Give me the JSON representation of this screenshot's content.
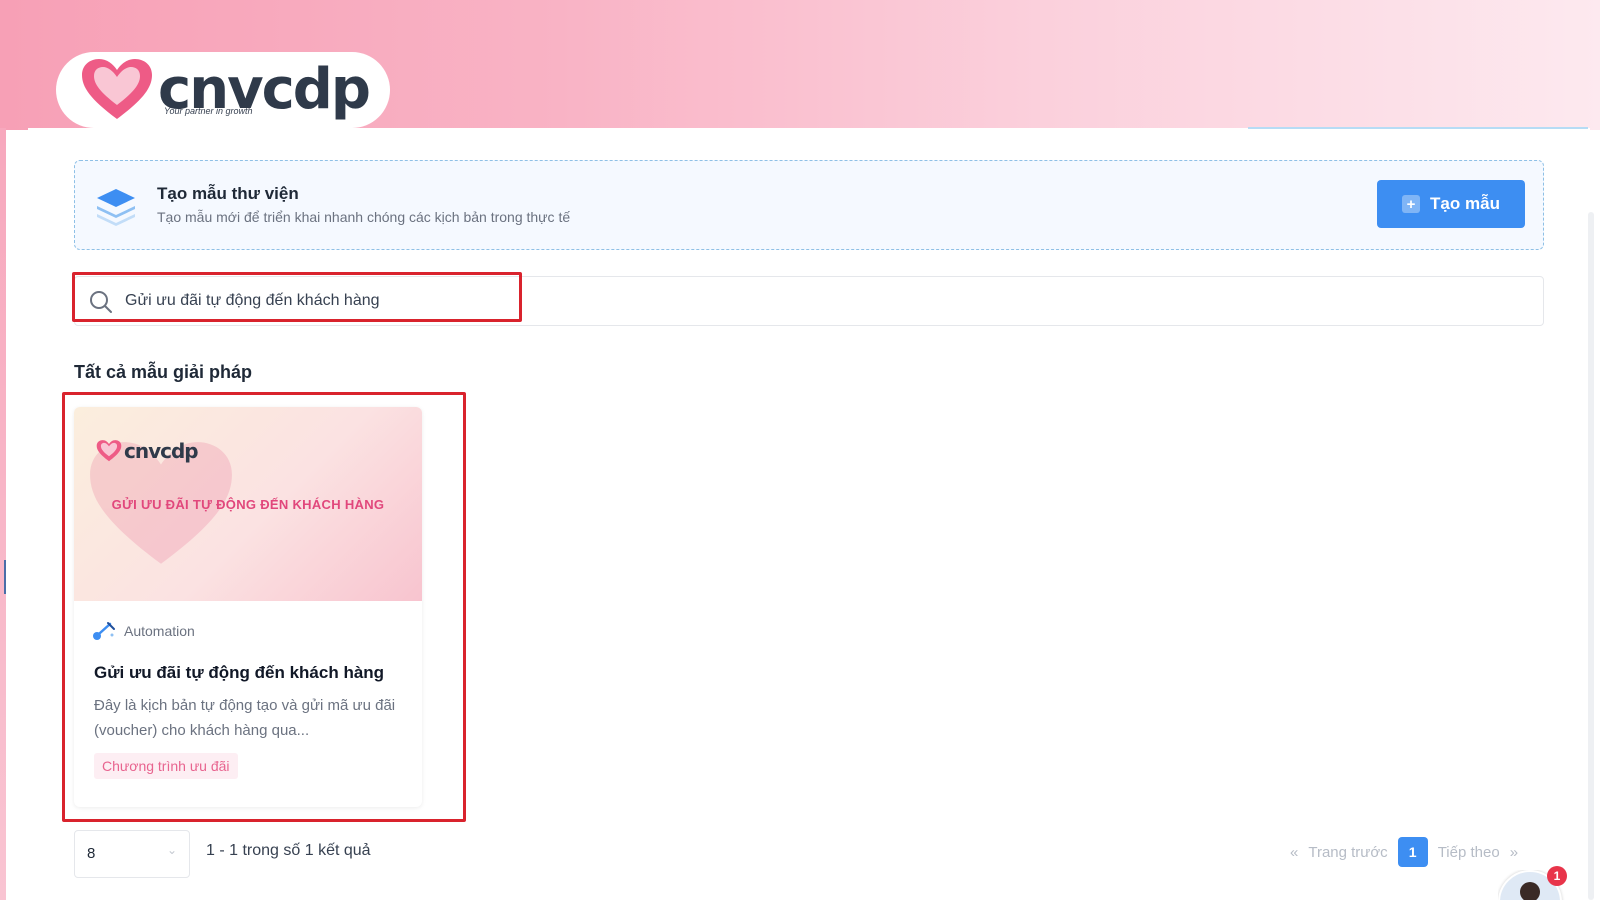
{
  "brand": {
    "name": "cnvcdp",
    "tagline": "Your partner in growth",
    "accent_color": "#f7a0b6",
    "primary_color": "#3d8ef2",
    "highlight_color": "#d9232d"
  },
  "banner": {
    "icon": "layers-icon",
    "title": "Tạo mẫu thư viện",
    "description": "Tạo mẫu mới để triển khai nhanh chóng các kịch bản trong thực tế",
    "create_button_label": "Tạo mẫu"
  },
  "search": {
    "value": "Gửi ưu đãi tự động đến khách hàng",
    "placeholder": ""
  },
  "section": {
    "title": "Tất cả mẫu giải pháp"
  },
  "cards": [
    {
      "thumb_logo": "cnvcdp",
      "thumb_title": "GỬI ƯU ĐÃI TỰ ĐỘNG ĐẾN KHÁCH HÀNG",
      "category": "Automation",
      "title": "Gửi ưu đãi tự động đến khách hàng",
      "description": "Đây là kịch bản tự động tạo và gửi mã ưu đãi (voucher) cho khách hàng qua...",
      "tag": "Chương trình ưu đãi"
    }
  ],
  "pagination": {
    "per_page": "8",
    "result_summary": "1 - 1 trong số 1 kết quả",
    "prev_label": "Trang trước",
    "next_label": "Tiếp theo",
    "current_page": "1"
  },
  "support": {
    "notification_count": "1"
  }
}
